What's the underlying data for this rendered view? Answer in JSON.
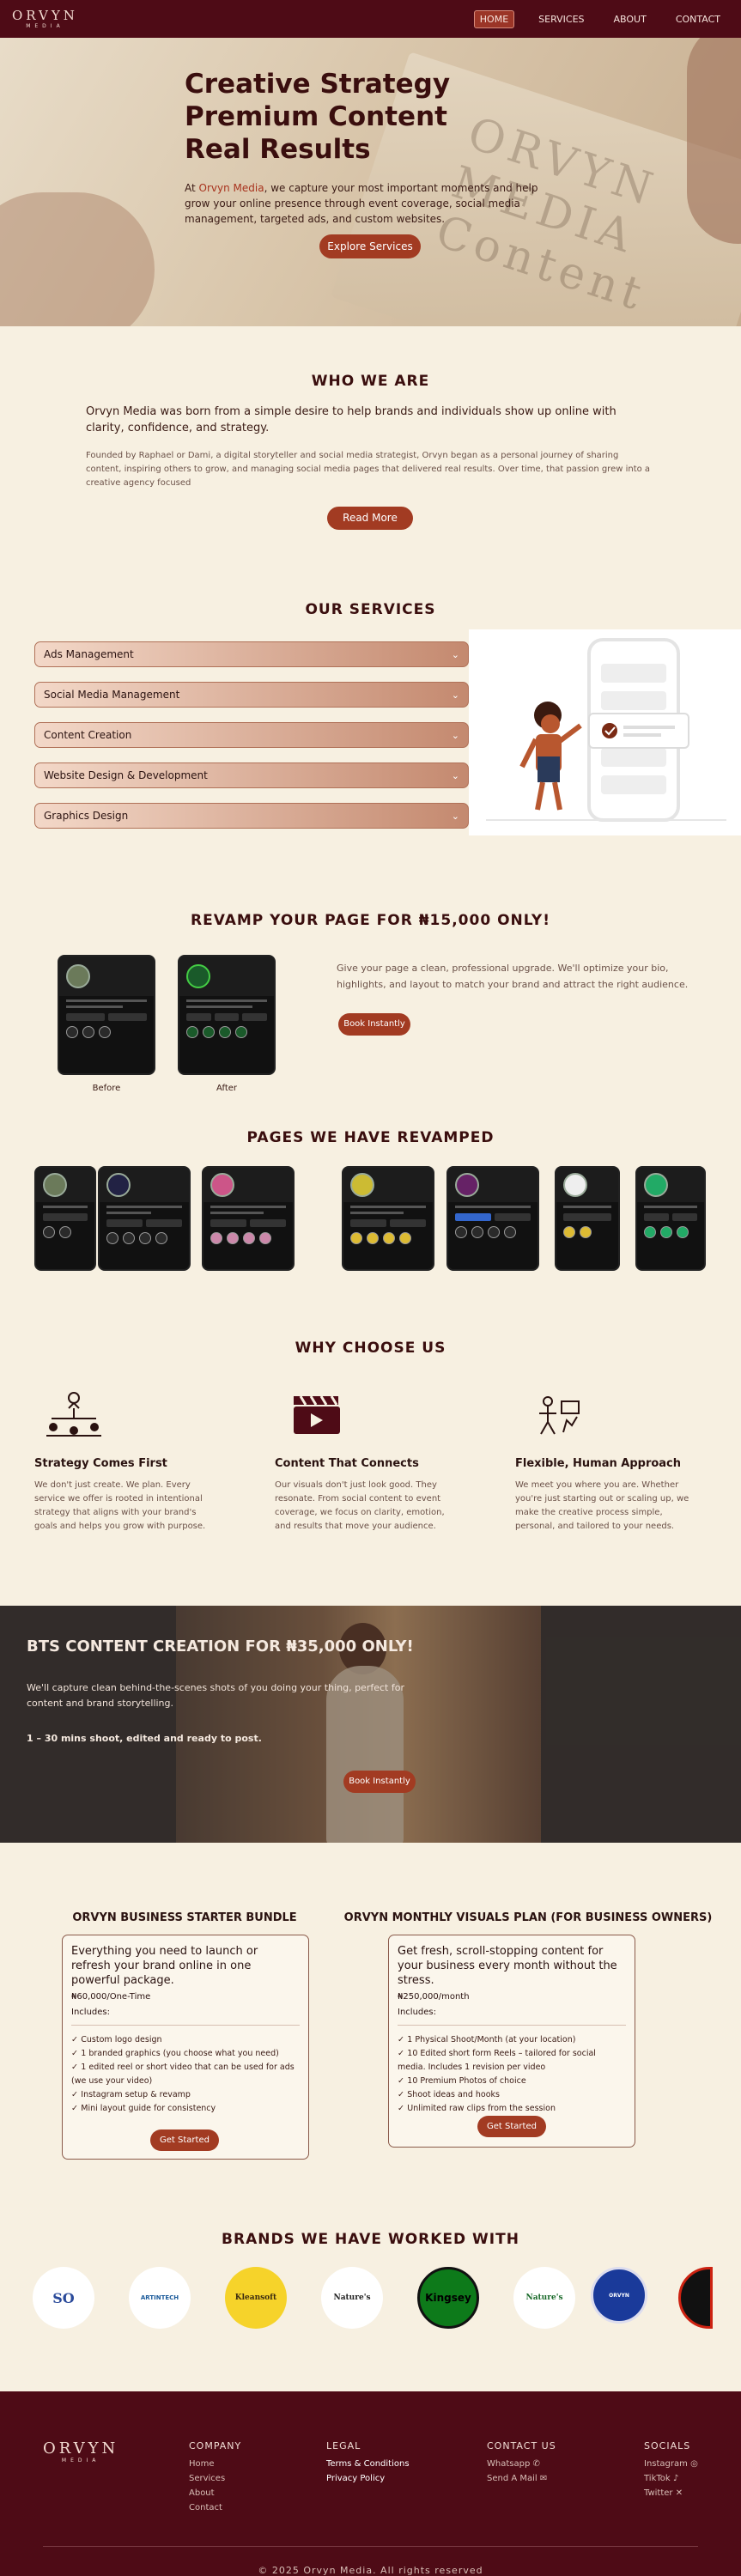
{
  "nav": {
    "logo_main": "ORVYN",
    "logo_sub": "MEDIA",
    "links": [
      "HOME",
      "SERVICES",
      "ABOUT",
      "CONTACT"
    ]
  },
  "hero": {
    "headline": [
      "Creative Strategy",
      "Premium Content",
      "Real Results"
    ],
    "para_prefix": "At ",
    "para_brand": "Orvyn Media",
    "para_rest": ", we capture your most important moments and help grow your online presence through event coverage, social media management, targeted ads, and custom websites.",
    "button": "Explore Services",
    "card_text": "ORVYN MEDIA Content"
  },
  "who": {
    "title": "WHO WE ARE",
    "lead": "Orvyn Media was born from a simple desire to help brands and individuals show up online with clarity, confidence, and strategy.",
    "body": "Founded by Raphael or Dami, a digital storyteller and social media strategist, Orvyn began as a personal journey of sharing content, inspiring others to grow, and managing social media pages that delivered real results. Over time, that passion grew into a creative agency focused",
    "button": "Read More"
  },
  "services": {
    "title": "OUR SERVICES",
    "items": [
      "Ads Management",
      "Social Media Management",
      "Content Creation",
      "Website Design & Development",
      "Graphics Design"
    ]
  },
  "revamp": {
    "title": "REVAMP YOUR PAGE FOR ₦15,000 ONLY!",
    "before": "Before",
    "after": "After",
    "para": "Give your page a clean, professional upgrade. We'll optimize your bio, highlights, and layout to match your brand and attract the right audience.",
    "button": "Book Instantly"
  },
  "revamped": {
    "title": "PAGES WE HAVE REVAMPED"
  },
  "why": {
    "title": "WHY CHOOSE US",
    "items": [
      {
        "title": "Strategy Comes First",
        "text": "We don't just create. We plan. Every service we offer is rooted in intentional strategy that aligns with your brand's goals and helps you grow with purpose."
      },
      {
        "title": "Content That Connects",
        "text": "Our visuals don't just look good. They resonate. From social content to event coverage, we focus on clarity, emotion, and results that move your audience."
      },
      {
        "title": "Flexible, Human Approach",
        "text": "We meet you where you are. Whether you're just starting out or scaling up, we make the creative process simple, personal, and tailored to your needs."
      }
    ]
  },
  "bts": {
    "title": "BTS CONTENT CREATION FOR ₦35,000 ONLY!",
    "para": "We'll capture clean behind-the-scenes shots of you doing your thing, perfect for content and brand storytelling.",
    "note": "1 – 30 mins shoot, edited and ready to post.",
    "button": "Book Instantly"
  },
  "pricing": [
    {
      "title": "ORVYN BUSINESS STARTER BUNDLE",
      "headline": "Everything you need to launch or refresh your brand online in one powerful package.",
      "price": "₦60,000/One-Time",
      "includes": "Includes:",
      "items": [
        "Custom logo design",
        "1 branded graphics (you choose what you need)",
        "1 edited reel or short video that can be used for ads (we use your video)",
        "Instagram setup & revamp",
        "Mini layout guide for consistency"
      ],
      "button": "Get Started"
    },
    {
      "title": "ORVYN MONTHLY VISUALS PLAN (FOR BUSINESS OWNERS)",
      "headline": "Get fresh, scroll-stopping content for your business every month without the stress.",
      "price": "₦250,000/month",
      "includes": "Includes:",
      "items": [
        "1 Physical Shoot/Month (at your location)",
        "10 Edited short form Reels – tailored for social media. Includes 1 revision per video",
        "10 Premium Photos of choice",
        "Shoot ideas and hooks",
        "Unlimited raw clips from the session"
      ],
      "button": "Get Started"
    }
  ],
  "brands": {
    "title": "BRANDS WE HAVE WORKED WITH",
    "logos": [
      "SO",
      "ARTINTECH",
      "Kleansoft",
      "Nature's",
      "Kingsey",
      "Nature's",
      "ORVYN",
      ""
    ]
  },
  "footer": {
    "logo_main": "ORVYN",
    "logo_sub": "MEDIA",
    "company_title": "COMPANY",
    "company_links": [
      "Home",
      "Services",
      "About",
      "Contact"
    ],
    "legal_title": "LEGAL",
    "legal_links": [
      "Terms & Conditions",
      "Privacy Policy"
    ],
    "contact_title": "CONTACT US",
    "contact_links": [
      "Whatsapp",
      "Send A Mail"
    ],
    "socials_title": "SOCIALS",
    "socials_links": [
      "Instagram",
      "TikTok",
      "Twitter"
    ],
    "copyright": "© 2025 Orvyn Media. All rights reserved"
  },
  "colors": {
    "brand": "#4e0b16",
    "accent": "#a23b22",
    "cream": "#f7f0e1"
  }
}
